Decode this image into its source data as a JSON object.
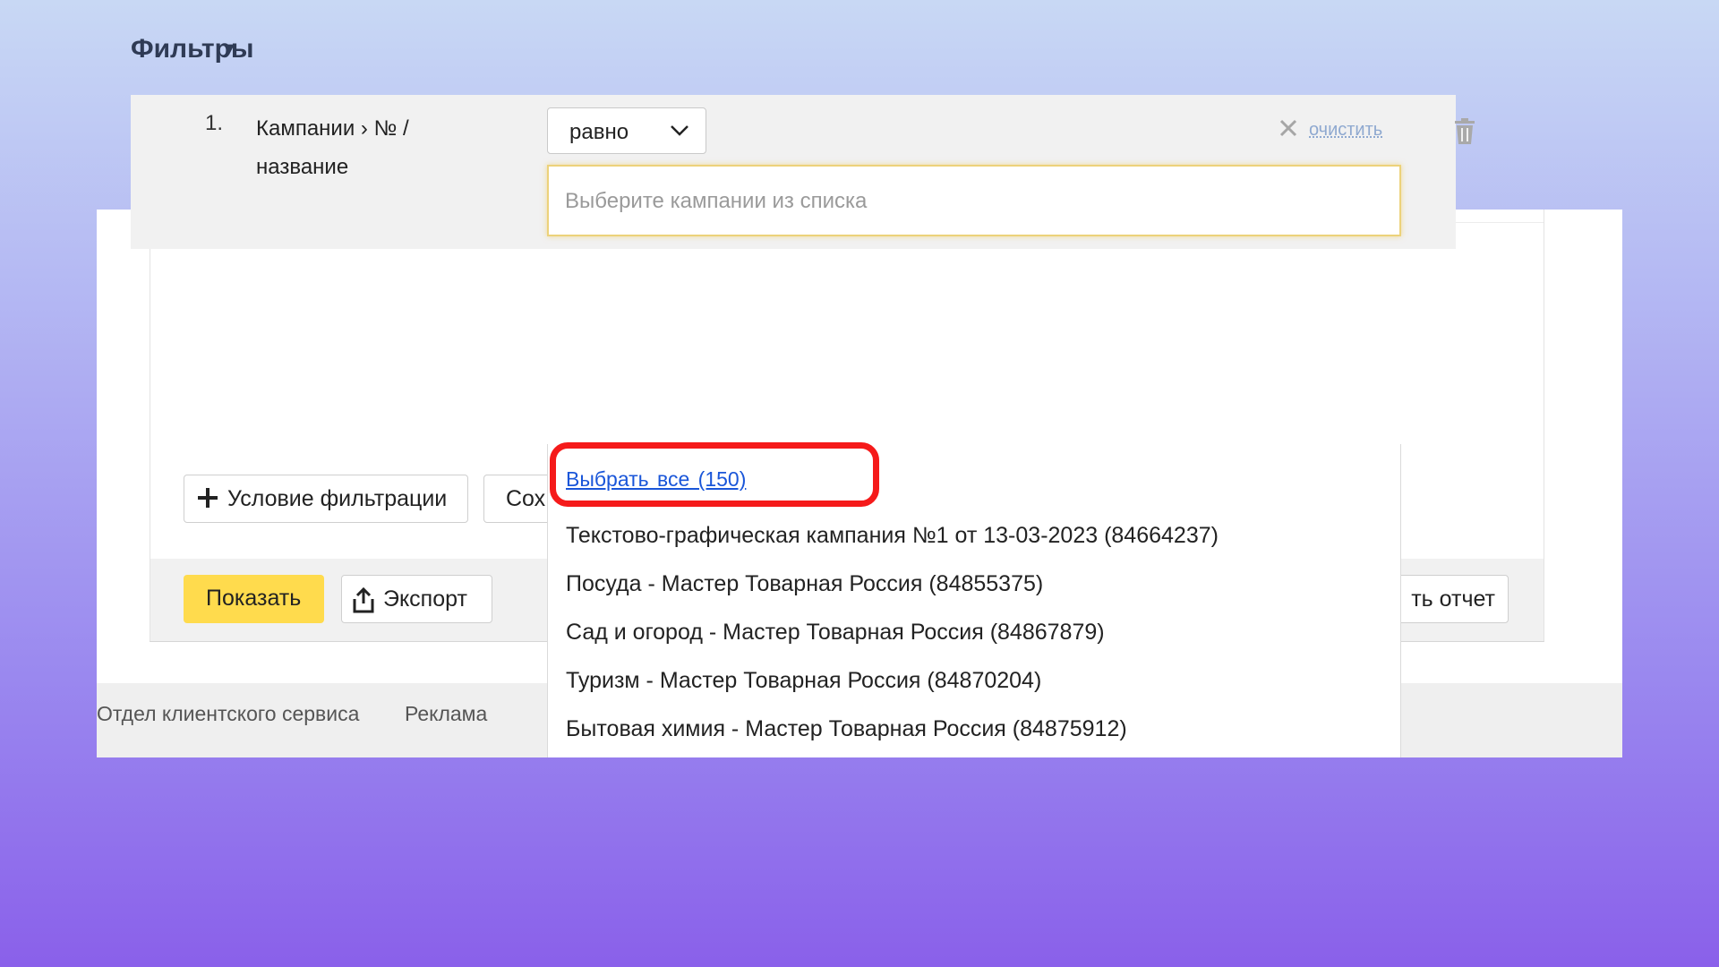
{
  "filters": {
    "title": "Фильтры",
    "caret": "▼",
    "rows": [
      {
        "number": "1.",
        "field_line1": "Кампании › № /",
        "field_line2": "название",
        "operator": "равно",
        "clear_label": "очистить",
        "input_placeholder": "Выберите кампании из списка"
      }
    ],
    "add_condition_label": "Условие фильтрации",
    "save_label_partial": "Сох"
  },
  "actions": {
    "show_label": "Показать",
    "export_label": "Экспорт",
    "report_label_partial": "ть отчет"
  },
  "dropdown": {
    "select_all_label": "Выбрать все  (150)",
    "items": [
      "Текстово-графическая кампания №1 от 13-03-2023 (84664237)",
      "Посуда - Мастер Товарная Россия (84855375)",
      "Сад и огород - Мастер Товарная Россия (84867879)",
      "Туризм - Мастер Товарная Россия (84870204)",
      "Бытовая химия - Мастер Товарная Россия (84875912)"
    ]
  },
  "footer": {
    "links": [
      "Отдел клиентского сервиса",
      "Реклама"
    ]
  },
  "colors": {
    "primary_button": "#ffdb4d",
    "link": "#1a56d9",
    "highlight": "#f51a1a",
    "input_focus": "#ecd27a"
  },
  "icons": [
    "chevron-down-icon",
    "close-icon",
    "trash-icon",
    "plus-icon",
    "export-icon"
  ]
}
